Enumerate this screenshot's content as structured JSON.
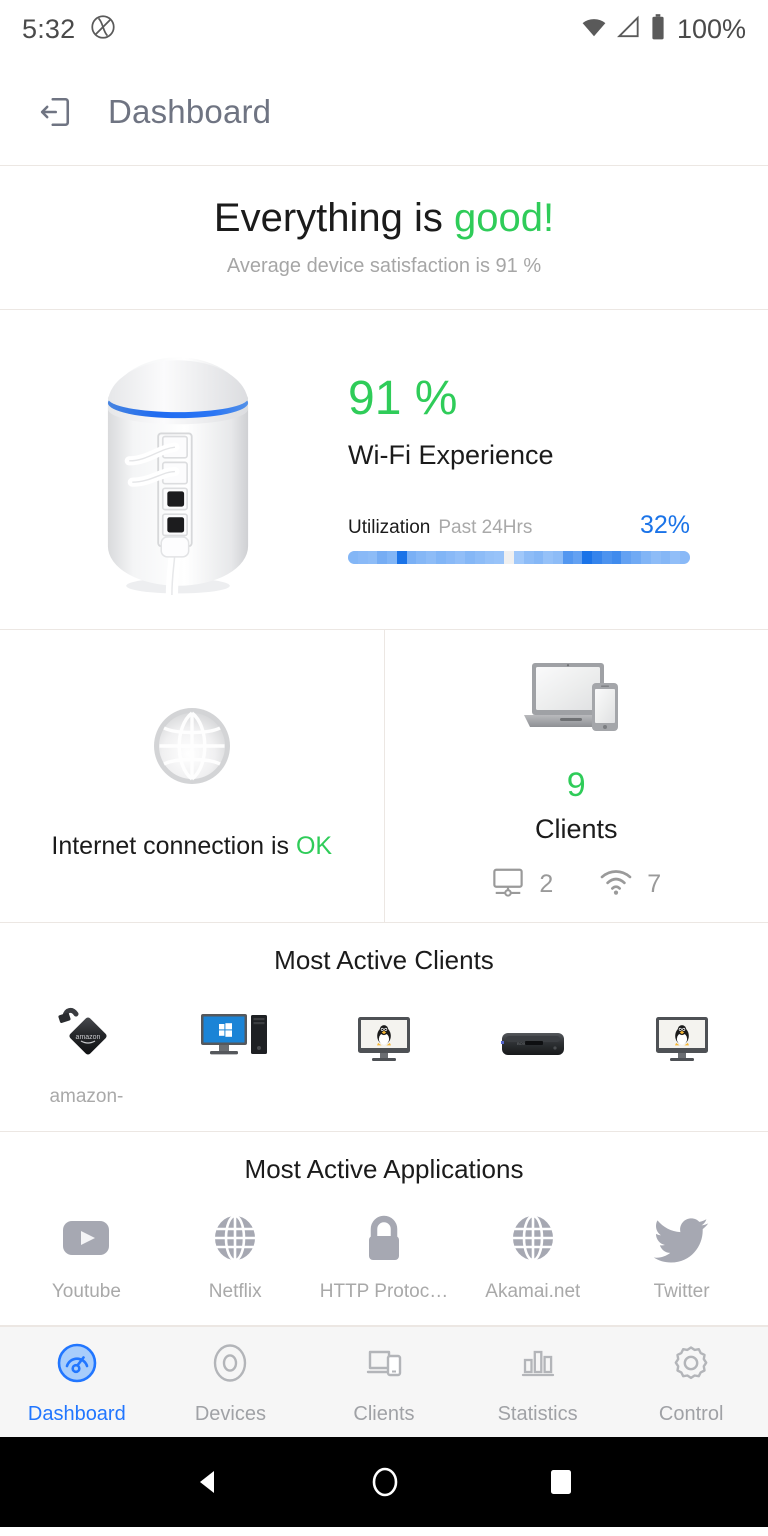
{
  "status_bar": {
    "time": "5:32",
    "no_sim_icon": "no-sim-icon",
    "wifi_icon": "wifi-icon",
    "signal_icon": "cellular-signal-icon",
    "battery_icon": "battery-icon",
    "battery_text": "100%"
  },
  "app_bar": {
    "back_icon": "exit-door-icon",
    "title": "Dashboard"
  },
  "hero": {
    "title_prefix": "Everything is ",
    "title_accent": "good!",
    "subtitle": "Average device satisfaction is 91 %"
  },
  "wifi_panel": {
    "device_icon": "router-device-icon",
    "score": "91 %",
    "score_label": "Wi-Fi Experience",
    "utilization_label": "Utilization",
    "utilization_period": "Past 24Hrs",
    "utilization_value": "32%"
  },
  "internet_card": {
    "icon": "globe-icon",
    "text_prefix": "Internet connection is ",
    "status": "OK"
  },
  "clients_card": {
    "icon": "laptop-phone-icon",
    "count": "9",
    "label": "Clients",
    "wired_icon": "wired-client-icon",
    "wired_count": "2",
    "wireless_icon": "wifi-client-icon",
    "wireless_count": "7"
  },
  "most_active_clients": {
    "title": "Most Active Clients",
    "items": [
      {
        "icon": "amazon-firestick-icon",
        "label": "amazon-"
      },
      {
        "icon": "windows-desktop-icon",
        "label": ""
      },
      {
        "icon": "linux-monitor-icon",
        "label": ""
      },
      {
        "icon": "settop-box-icon",
        "label": ""
      },
      {
        "icon": "linux-monitor-icon",
        "label": ""
      }
    ]
  },
  "most_active_applications": {
    "title": "Most Active Applications",
    "items": [
      {
        "icon": "youtube-icon",
        "label": "Youtube"
      },
      {
        "icon": "globe-icon",
        "label": "Netflix"
      },
      {
        "icon": "lock-icon",
        "label": "HTTP Protoc…"
      },
      {
        "icon": "globe-icon",
        "label": "Akamai.net"
      },
      {
        "icon": "twitter-bird-icon",
        "label": "Twitter"
      }
    ]
  },
  "bottom_nav": {
    "items": [
      {
        "icon": "gauge-icon",
        "label": "Dashboard",
        "active": true
      },
      {
        "icon": "circle-icon",
        "label": "Devices",
        "active": false
      },
      {
        "icon": "devices-icon",
        "label": "Clients",
        "active": false
      },
      {
        "icon": "bar-chart-icon",
        "label": "Statistics",
        "active": false
      },
      {
        "icon": "gear-icon",
        "label": "Control",
        "active": false
      }
    ]
  },
  "system_nav": {
    "back_icon": "android-back-icon",
    "home_icon": "android-home-icon",
    "recents_icon": "android-recents-icon"
  },
  "colors": {
    "green": "#2fcc59",
    "blue": "#1a73e8",
    "nav_active": "#2176ff",
    "muted": "#a9a9a9",
    "divider": "#ece7e3"
  },
  "utilization_segments": [
    0.45,
    0.42,
    0.4,
    0.52,
    0.46,
    1.0,
    0.5,
    0.44,
    0.4,
    0.46,
    0.42,
    0.38,
    0.44,
    0.4,
    0.36,
    0.34,
    0.08,
    0.3,
    0.4,
    0.44,
    0.36,
    0.4,
    0.7,
    0.62,
    1.0,
    0.86,
    0.74,
    0.8,
    0.62,
    0.55,
    0.46,
    0.4,
    0.44,
    0.38,
    0.42
  ]
}
